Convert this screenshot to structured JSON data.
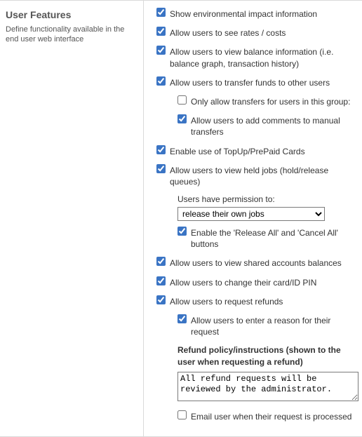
{
  "section": {
    "title": "User Features",
    "description": "Define functionality available in the end user web interface"
  },
  "opts": {
    "env_impact": {
      "label": "Show environmental impact information",
      "checked": true
    },
    "see_rates": {
      "label": "Allow users to see rates / costs",
      "checked": true
    },
    "view_balance": {
      "label": "Allow users to view balance information (i.e. balance graph, transaction history)",
      "checked": true
    },
    "transfer_funds": {
      "label": "Allow users to transfer funds to other users",
      "checked": true
    },
    "transfer_group_only": {
      "label": "Only allow transfers for users in this group:",
      "checked": false
    },
    "transfer_comments": {
      "label": "Allow users to add comments to manual transfers",
      "checked": true
    },
    "topup": {
      "label": "Enable use of TopUp/PrePaid Cards",
      "checked": true
    },
    "held_jobs": {
      "label": "Allow users to view held jobs (hold/release queues)",
      "checked": true
    },
    "permission_label": "Users have permission to:",
    "permission_value": "release their own jobs",
    "release_cancel_all": {
      "label": "Enable the 'Release All' and 'Cancel All' buttons",
      "checked": true
    },
    "shared_accounts": {
      "label": "Allow users to view shared accounts balances",
      "checked": true
    },
    "change_pin": {
      "label": "Allow users to change their card/ID PIN",
      "checked": true
    },
    "request_refunds": {
      "label": "Allow users to request refunds",
      "checked": true
    },
    "refund_reason": {
      "label": "Allow users to enter a reason for their request",
      "checked": true
    },
    "refund_policy_label": "Refund policy/instructions (shown to the user when requesting a refund)",
    "refund_policy_text": "All refund requests will be reviewed by the administrator.",
    "email_on_process": {
      "label": "Email user when their request is processed",
      "checked": false
    }
  }
}
